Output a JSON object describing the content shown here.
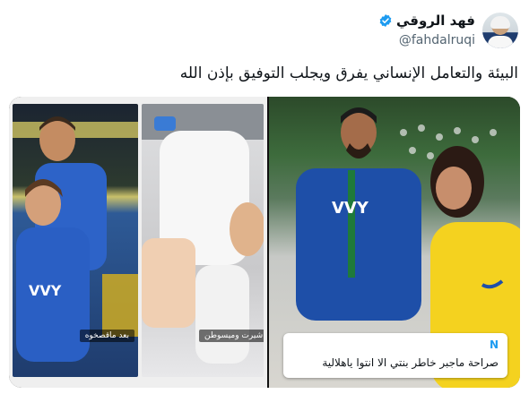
{
  "author": {
    "display_name": "فهد الروقي",
    "handle": "@fahdalruqi",
    "verified": true
  },
  "tweet": {
    "text": "البيئة والتعامل الإنساني يفرق ويجلب التوفيق بإذن الله"
  },
  "media": {
    "left_image": {
      "caption_left": "بعد ماقصخوه",
      "caption_right": "شيرت وميسوطن"
    },
    "right_image": {
      "reply_card": {
        "initial": "N",
        "text": "صراحة ماجبر خاطر بنتي الا انتوا ياهلالية"
      }
    }
  },
  "colors": {
    "verified_blue": "#1d9bf0",
    "hilal_blue": "#1e4fa8",
    "nassr_yellow": "#f4d21f"
  }
}
